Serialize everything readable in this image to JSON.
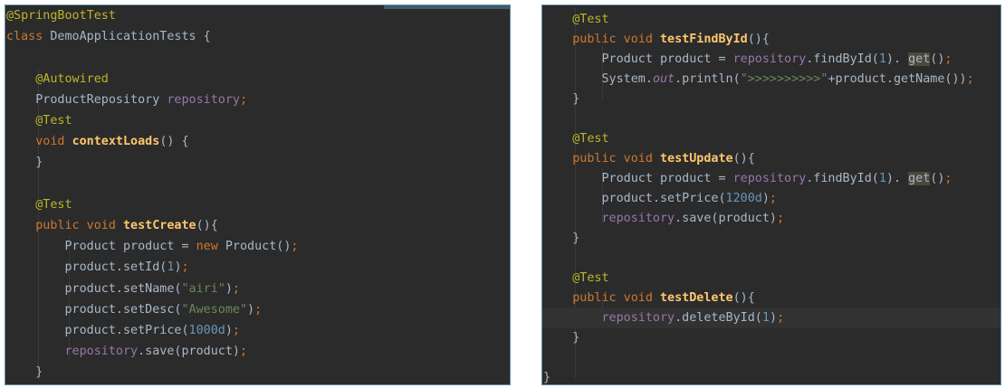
{
  "colors": {
    "background": "#2b2b2b",
    "border": "#5f8fa3",
    "keyword": "#cc7832",
    "annotation": "#bbb529",
    "function": "#ffc66d",
    "field": "#9876aa",
    "string": "#6a8759",
    "number": "#6897bb",
    "text": "#a9b7c6"
  },
  "left": {
    "lines": [
      [
        [
          "annotation",
          "@SpringBootTest"
        ]
      ],
      [
        [
          "kw",
          "class "
        ],
        [
          "plain",
          "DemoApplicationTests {"
        ]
      ],
      [],
      [
        [
          "annotation",
          "    @Autowired"
        ]
      ],
      [
        [
          "plain",
          "    ProductRepository "
        ],
        [
          "field",
          "repository"
        ],
        [
          "punct",
          ";"
        ]
      ],
      [
        [
          "annotation",
          "    @Test"
        ]
      ],
      [
        [
          "kw",
          "    void "
        ],
        [
          "fn",
          "contextLoads"
        ],
        [
          "plain",
          "() {"
        ]
      ],
      [
        [
          "plain",
          "    }"
        ]
      ],
      [],
      [
        [
          "annotation",
          "    @Test"
        ]
      ],
      [
        [
          "kw",
          "    public void "
        ],
        [
          "fn",
          "testCreate"
        ],
        [
          "plain",
          "(){"
        ]
      ],
      [
        [
          "plain",
          "        Product product = "
        ],
        [
          "kw",
          "new "
        ],
        [
          "plain",
          "Product()"
        ],
        [
          "punct",
          ";"
        ]
      ],
      [
        [
          "plain",
          "        product.setId("
        ],
        [
          "num",
          "1"
        ],
        [
          "plain",
          ")"
        ],
        [
          "punct",
          ";"
        ]
      ],
      [
        [
          "plain",
          "        product.setName("
        ],
        [
          "str",
          "\"airi\""
        ],
        [
          "plain",
          ")"
        ],
        [
          "punct",
          ";"
        ]
      ],
      [
        [
          "plain",
          "        product.setDesc("
        ],
        [
          "str",
          "\"Awesome\""
        ],
        [
          "plain",
          ")"
        ],
        [
          "punct",
          ";"
        ]
      ],
      [
        [
          "plain",
          "        product.setPrice("
        ],
        [
          "num",
          "1000d"
        ],
        [
          "plain",
          ")"
        ],
        [
          "punct",
          ";"
        ]
      ],
      [
        [
          "field",
          "        repository"
        ],
        [
          "plain",
          ".save(product)"
        ],
        [
          "punct",
          ";"
        ]
      ],
      [
        [
          "plain",
          "    }"
        ]
      ]
    ]
  },
  "right": {
    "lines": [
      [
        [
          "annotation",
          "    @Test"
        ]
      ],
      [
        [
          "kw",
          "    public void "
        ],
        [
          "fn",
          "testFindById"
        ],
        [
          "plain",
          "(){"
        ]
      ],
      [
        [
          "plain",
          "        Product product = "
        ],
        [
          "field",
          "repository"
        ],
        [
          "plain",
          ".findById("
        ],
        [
          "num",
          "1"
        ],
        [
          "plain",
          "). "
        ],
        [
          "hl",
          "get"
        ],
        [
          "plain",
          "()"
        ],
        [
          "punct",
          ";"
        ]
      ],
      [
        [
          "plain",
          "        System."
        ],
        [
          "ifield",
          "out"
        ],
        [
          "plain",
          ".println("
        ],
        [
          "str",
          "\">>>>>>>>>>\""
        ],
        [
          "plain",
          "+product.getName())"
        ],
        [
          "punct",
          ";"
        ]
      ],
      [
        [
          "plain",
          "    }"
        ]
      ],
      [],
      [
        [
          "annotation",
          "    @Test"
        ]
      ],
      [
        [
          "kw",
          "    public void "
        ],
        [
          "fn",
          "testUpdate"
        ],
        [
          "plain",
          "(){"
        ]
      ],
      [
        [
          "plain",
          "        Product product = "
        ],
        [
          "field",
          "repository"
        ],
        [
          "plain",
          ".findById("
        ],
        [
          "num",
          "1"
        ],
        [
          "plain",
          "). "
        ],
        [
          "hl",
          "get"
        ],
        [
          "plain",
          "()"
        ],
        [
          "punct",
          ";"
        ]
      ],
      [
        [
          "plain",
          "        product.setPrice("
        ],
        [
          "num",
          "1200d"
        ],
        [
          "plain",
          ")"
        ],
        [
          "punct",
          ";"
        ]
      ],
      [
        [
          "field",
          "        repository"
        ],
        [
          "plain",
          ".save(product)"
        ],
        [
          "punct",
          ";"
        ]
      ],
      [
        [
          "plain",
          "    }"
        ]
      ],
      [],
      [
        [
          "annotation",
          "    @Test"
        ]
      ],
      [
        [
          "kw",
          "    public void "
        ],
        [
          "fn",
          "testDelete"
        ],
        [
          "plain",
          "(){"
        ]
      ],
      [
        [
          "field",
          "        repository"
        ],
        [
          "plain",
          ".deleteById("
        ],
        [
          "num",
          "1"
        ],
        [
          "plain",
          ")"
        ],
        [
          "punct",
          ";"
        ]
      ],
      [
        [
          "plain",
          "    }"
        ]
      ],
      [],
      [
        [
          "plain",
          "}"
        ]
      ]
    ]
  }
}
